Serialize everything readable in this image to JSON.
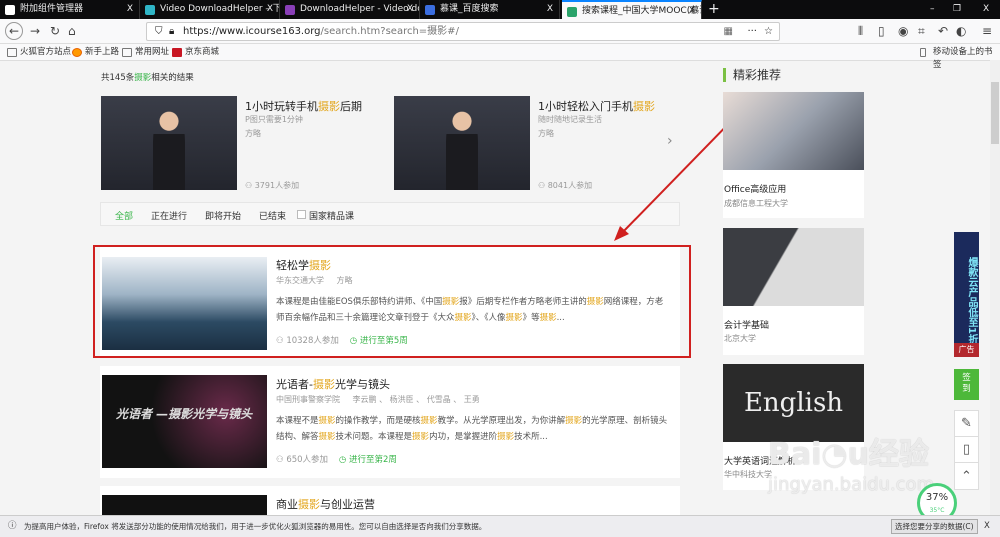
{
  "browser": {
    "tabs": [
      {
        "label": "附加组件管理器",
        "color": "#ffffff"
      },
      {
        "label": "Video DownloadHelper – 下载",
        "color": "#2fb5c6"
      },
      {
        "label": "DownloadHelper - Video do",
        "color": "#8a3fb8"
      },
      {
        "label": "慕课_百度搜索",
        "color": "#3b6ee0"
      },
      {
        "label": "搜索课程_中国大学MOOC(慕课)",
        "color": "#2aa36a"
      }
    ],
    "close": "X",
    "new_tab": "+",
    "win_min": "–",
    "win_max": "❐",
    "win_close": "X",
    "url_host": "https://www.icourse163.org",
    "url_path": "/search.htm?search=摄影#/",
    "more": "···",
    "star": "☆",
    "bookmarks": [
      "火狐官方站点",
      "新手上路",
      "常用网址",
      "京东商城"
    ],
    "mobile_bookmarks": "移动设备上的书签"
  },
  "search": {
    "count_pre": "共145条",
    "keyword": "摄影",
    "count_post": "相关的结果"
  },
  "top_courses": [
    {
      "t1": "1小时玩转手机",
      "t2": "摄影",
      "t3": "后期",
      "sub": "P图只需要1分钟",
      "teacher": "方略",
      "count": "3791人参加"
    },
    {
      "t1": "1小时轻松入门手机",
      "t2": "摄影",
      "t3": "",
      "sub": "随时随地记录生活",
      "teacher": "方略",
      "count": "8041人参加"
    }
  ],
  "filters": {
    "all": "全部",
    "ongoing": "正在进行",
    "upcoming": "即将开始",
    "ended": "已结束",
    "national": "国家精品课"
  },
  "courses": [
    {
      "title": [
        [
          "轻松学",
          0
        ],
        [
          "摄影",
          1
        ]
      ],
      "school": "华东交通大学",
      "teachers": "方略",
      "desc": [
        [
          "本课程是由佳能EOS俱乐部特约讲师、《中国",
          0
        ],
        [
          "摄影",
          1
        ],
        [
          "报》后期专栏作者方略老师主讲的",
          0
        ],
        [
          "摄影",
          1
        ],
        [
          "网络课程，方老师百余幅作品和三十余篇理论文章刊登于《大众",
          0
        ],
        [
          "摄影",
          1
        ],
        [
          "》、《人像",
          0
        ],
        [
          "摄影",
          1
        ],
        [
          "》等",
          0
        ],
        [
          "摄影",
          1
        ],
        [
          "...",
          0
        ]
      ],
      "count": "10328人参加",
      "status": "进行至第5周"
    },
    {
      "title": [
        [
          "光语者-",
          0
        ],
        [
          "摄影",
          1
        ],
        [
          "光学与镜头",
          0
        ]
      ],
      "school": "中国刑事警察学院",
      "teachers": "李云鹏 、 杨洪臣 、 代雪晶 、 王勇",
      "desc": [
        [
          "本课程不是",
          0
        ],
        [
          "摄影",
          1
        ],
        [
          "的操作教学，而是硬核",
          0
        ],
        [
          "摄影",
          1
        ],
        [
          "教学。从光学原理出发，为你讲解",
          0
        ],
        [
          "摄影",
          1
        ],
        [
          "的光学原理、剖析镜头结构、解答",
          0
        ],
        [
          "摄影",
          1
        ],
        [
          "技术问题。本课程是",
          0
        ],
        [
          "摄影",
          1
        ],
        [
          "内功，是掌握进阶",
          0
        ],
        [
          "摄影",
          1
        ],
        [
          "技术所...",
          0
        ]
      ],
      "count": "650人参加",
      "status": "进行至第2周",
      "thumb_text": "光语者 —摄影光学与镜头"
    },
    {
      "title": [
        [
          "商业",
          0
        ],
        [
          "摄影",
          1
        ],
        [
          "与创业运营",
          0
        ]
      ]
    }
  ],
  "recommend": {
    "heading": "精彩推荐",
    "items": [
      {
        "title": "Office高级应用",
        "school": "成都信息工程大学"
      },
      {
        "title": "会计学基础",
        "school": "北京大学"
      },
      {
        "title": "大学英语词汇解析",
        "school": "华中科技大学",
        "thumb_text": "English"
      }
    ]
  },
  "side": {
    "ad_text": "爆款云产品低至1折",
    "ad_label": "广告",
    "sign": "签到"
  },
  "widget": {
    "percent": "37%",
    "temp": "35°C"
  },
  "watermark": "Baidu经验 jingyan.baidu.com",
  "notify": {
    "text": "为提高用户体验，Firefox 将发送部分功能的使用情况给我们，用于进一步优化火狐浏览器的易用性。您可以自由选择是否向我们分享数据。",
    "button": "选择您要分享的数据(C)",
    "close": "X"
  },
  "colors": {
    "accent": "#39b54a",
    "highlight": "#e3a71f",
    "annotation": "#d0201f"
  }
}
